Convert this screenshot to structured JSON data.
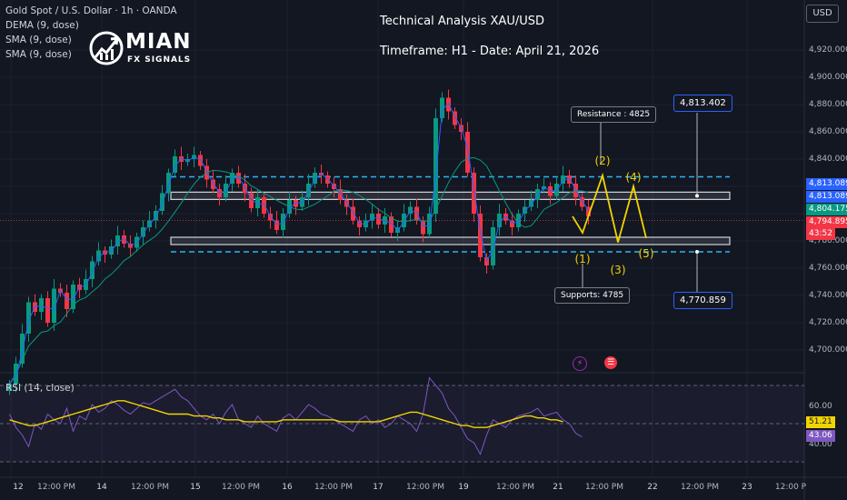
{
  "symbol": {
    "name": "Gold Spot / U.S. Dollar · 1h · OANDA"
  },
  "indicators": [
    "DEMA (9, dose)",
    "SMA (9, dose)",
    "SMA (9, dose)"
  ],
  "logo": {
    "main": "MIAN",
    "sub": "FX SIGNALS"
  },
  "header": {
    "title": "Technical Analysis XAU/USD",
    "subtitle": "Timeframe: H1 - Date: April 21, 2026"
  },
  "currency": "USD",
  "price_axis": [
    "4,920.000",
    "4,900.000",
    "4,880.000",
    "4,860.000",
    "4,840.000",
    "4,780.000",
    "4,760.000",
    "4,740.000",
    "4,720.000",
    "4,700.000"
  ],
  "price_tags": [
    {
      "value": "4,813.089",
      "color": "#2962ff"
    },
    {
      "value": "4,813.089",
      "color": "#2962ff"
    },
    {
      "value": "4,804.175",
      "color": "#089981"
    },
    {
      "value": "4,794.895",
      "color": "#f23645"
    },
    {
      "value": "43:52",
      "color": "#f23645"
    }
  ],
  "annotations": {
    "resistance_label": "Resistance : 4825",
    "support_label": "Supports: 4785",
    "upper_target": "4,813.402",
    "lower_target": "4,770.859",
    "waves": [
      "(1)",
      "(2)",
      "(3)",
      "(4)",
      "(5)"
    ]
  },
  "rsi": {
    "label": "RSI (14, close)",
    "axis": [
      "60.00",
      "40.00"
    ],
    "tags": [
      {
        "value": "51.21",
        "color": "#f0d400"
      },
      {
        "value": "43.06",
        "color": "#7e57c2"
      }
    ]
  },
  "time_axis": [
    {
      "label": "12",
      "day": true
    },
    {
      "label": "12:00 PM",
      "day": false
    },
    {
      "label": "14",
      "day": true
    },
    {
      "label": "12:00 PM",
      "day": false
    },
    {
      "label": "15",
      "day": true
    },
    {
      "label": "12:00 PM",
      "day": false
    },
    {
      "label": "16",
      "day": true
    },
    {
      "label": "12:00 PM",
      "day": false
    },
    {
      "label": "17",
      "day": true
    },
    {
      "label": "12:00 PM",
      "day": false
    },
    {
      "label": "19",
      "day": true
    },
    {
      "label": "12:00 PM",
      "day": false
    },
    {
      "label": "21",
      "day": true
    },
    {
      "label": "12:00 PM",
      "day": false
    },
    {
      "label": "22",
      "day": true
    },
    {
      "label": "12:00 PM",
      "day": false
    },
    {
      "label": "23",
      "day": true
    },
    {
      "label": "12:00 P",
      "day": false
    }
  ],
  "colors": {
    "bull": "#089981",
    "bear": "#f23645",
    "dema": "#2962ff",
    "sma": "#f0d400",
    "zone": "#b2b5be",
    "dashed": "#29b6f6",
    "wave": "#f0d400"
  },
  "chart_data": {
    "type": "candlestick",
    "symbol": "XAUUSD",
    "timeframe": "1h",
    "ylim": [
      4680,
      4935
    ],
    "close": [
      4675,
      4690,
      4712,
      4735,
      4728,
      4738,
      4720,
      4745,
      4742,
      4730,
      4748,
      4744,
      4752,
      4765,
      4773,
      4770,
      4776,
      4784,
      4778,
      4775,
      4783,
      4790,
      4795,
      4802,
      4815,
      4830,
      4842,
      4838,
      4840,
      4843,
      4835,
      4825,
      4818,
      4812,
      4822,
      4830,
      4822,
      4815,
      4804,
      4812,
      4800,
      4795,
      4788,
      4800,
      4810,
      4805,
      4812,
      4822,
      4830,
      4828,
      4822,
      4818,
      4810,
      4805,
      4795,
      4790,
      4795,
      4800,
      4792,
      4798,
      4786,
      4790,
      4800,
      4805,
      4795,
      4785,
      4800,
      4870,
      4885,
      4875,
      4865,
      4860,
      4830,
      4800,
      4768,
      4762,
      4790,
      4800,
      4795,
      4790,
      4800,
      4805,
      4810,
      4818,
      4820,
      4813,
      4822,
      4828,
      4822,
      4812,
      4805,
      4798
    ],
    "support": 4785,
    "resistance": 4825,
    "zone_upper": 4813.089,
    "zone_lower": 4780,
    "dashed_upper": 4827,
    "dashed_lower": 4772,
    "targets": {
      "upper": 4813.402,
      "lower": 4770.859
    },
    "last_price": 4794.895,
    "projection": [
      4786,
      4828,
      4779,
      4820,
      4782
    ],
    "rsi": [
      55,
      48,
      44,
      38,
      50,
      47,
      55,
      52,
      50,
      58,
      46,
      54,
      52,
      60,
      56,
      58,
      62,
      60,
      57,
      55,
      58,
      61,
      60,
      62,
      64,
      66,
      68,
      64,
      62,
      58,
      54,
      52,
      55,
      50,
      56,
      60,
      52,
      50,
      48,
      54,
      50,
      48,
      46,
      53,
      55,
      52,
      56,
      60,
      58,
      55,
      54,
      52,
      50,
      48,
      46,
      52,
      54,
      50,
      52,
      48,
      50,
      54,
      52,
      50,
      46,
      55,
      74,
      70,
      66,
      58,
      54,
      48,
      42,
      40,
      34,
      44,
      52,
      50,
      48,
      52,
      54,
      55,
      56,
      58,
      54,
      55,
      56,
      52,
      50,
      45,
      43
    ],
    "rsi_sma": [
      52,
      51,
      50,
      49,
      49,
      50,
      51,
      52,
      53,
      54,
      55,
      56,
      57,
      58,
      59,
      60,
      61,
      62,
      62,
      61,
      60,
      59,
      58,
      57,
      56,
      55,
      55,
      55,
      55,
      54,
      54,
      54,
      53,
      53,
      52,
      52,
      52,
      51,
      51,
      51,
      51,
      51,
      51,
      52,
      52,
      52,
      52,
      52,
      52,
      52,
      52,
      52,
      51,
      51,
      51,
      51,
      51,
      51,
      51,
      52,
      53,
      54,
      55,
      56,
      56,
      55,
      54,
      53,
      52,
      51,
      50,
      49,
      49,
      48,
      48,
      48,
      49,
      50,
      51,
      52,
      53,
      54,
      54,
      53,
      53,
      52,
      52,
      51
    ]
  }
}
